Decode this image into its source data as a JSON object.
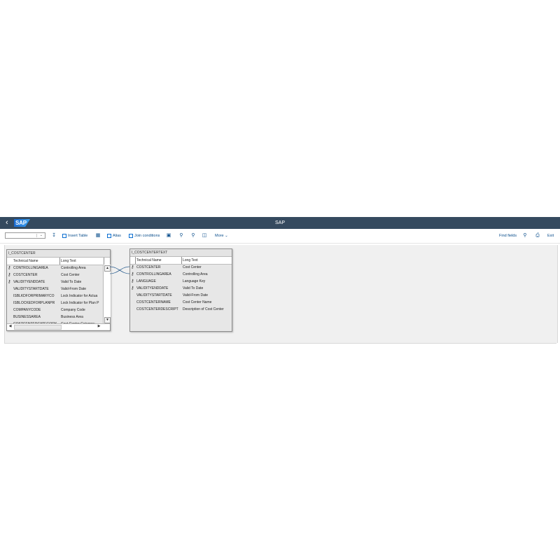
{
  "shell": {
    "back_glyph": "‹",
    "logo_text": "SAP",
    "title": "SAP"
  },
  "toolbar": {
    "dropdown_value": "",
    "insert_table": "Insert Table",
    "alias": "Alias",
    "join_conditions": "Join conditions",
    "more": "More",
    "find_fields": "Find fields",
    "exit": "Exit"
  },
  "icons": {
    "back": "back-icon",
    "import": "import-icon",
    "insert_table": "insert-table-icon",
    "delete": "delete-icon",
    "alias": "alias-icon",
    "join": "join-icon",
    "fit": "fit-to-screen-icon",
    "zoom_in": "zoom-in-icon",
    "zoom_out": "zoom-out-icon",
    "zoom_reset": "zoom-reset-icon",
    "search": "search-icon",
    "printer": "printer-icon"
  },
  "colors": {
    "shell_bg": "#354a5f",
    "link": "#0a4e8c",
    "canvas_bg": "#f0f0f0"
  },
  "table1": {
    "name": "I_COSTCENTER",
    "col_technical": "Technical Name",
    "col_long": "Long Text",
    "rows": [
      {
        "key": true,
        "technical": "CONTROLLINGAREA",
        "long": "Controlling Area"
      },
      {
        "key": true,
        "technical": "COSTCENTER",
        "long": "Cost Center"
      },
      {
        "key": true,
        "technical": "VALIDITYENDDATE",
        "long": "Valid To Date"
      },
      {
        "key": false,
        "technical": "VALIDITYSTARTDATE",
        "long": "Valid-From Date"
      },
      {
        "key": false,
        "technical": "ISBLKDFORPRIMARYCO",
        "long": "Lock Indicator for Actua"
      },
      {
        "key": false,
        "technical": "ISBLOCKEDFORPLANPR",
        "long": "Lock Indicator for Plan P"
      },
      {
        "key": false,
        "technical": "COMPANYCODE",
        "long": "Company Code"
      },
      {
        "key": false,
        "technical": "BUSINESSAREA",
        "long": "Business Area"
      },
      {
        "key": false,
        "technical": "COSTCENTERCATEGORY",
        "long": "Cost Center Category"
      }
    ]
  },
  "table2": {
    "name": "I_COSTCENTERTEXT",
    "col_technical": "Technical Name",
    "col_long": "Long Text",
    "rows": [
      {
        "key": true,
        "technical": "COSTCENTER",
        "long": "Cost Center"
      },
      {
        "key": true,
        "technical": "CONTROLLINGAREA",
        "long": "Controlling Area"
      },
      {
        "key": true,
        "technical": "LANGUAGE",
        "long": "Language Key"
      },
      {
        "key": true,
        "technical": "VALIDITYENDDATE",
        "long": "Valid To Date"
      },
      {
        "key": false,
        "technical": "VALIDITYSTARTDATE",
        "long": "Valid-From Date"
      },
      {
        "key": false,
        "technical": "COSTCENTERNAME",
        "long": "Cost Center Name"
      },
      {
        "key": false,
        "technical": "COSTCENTERDESCRIPT",
        "long": "Description of Cost Center"
      }
    ]
  }
}
